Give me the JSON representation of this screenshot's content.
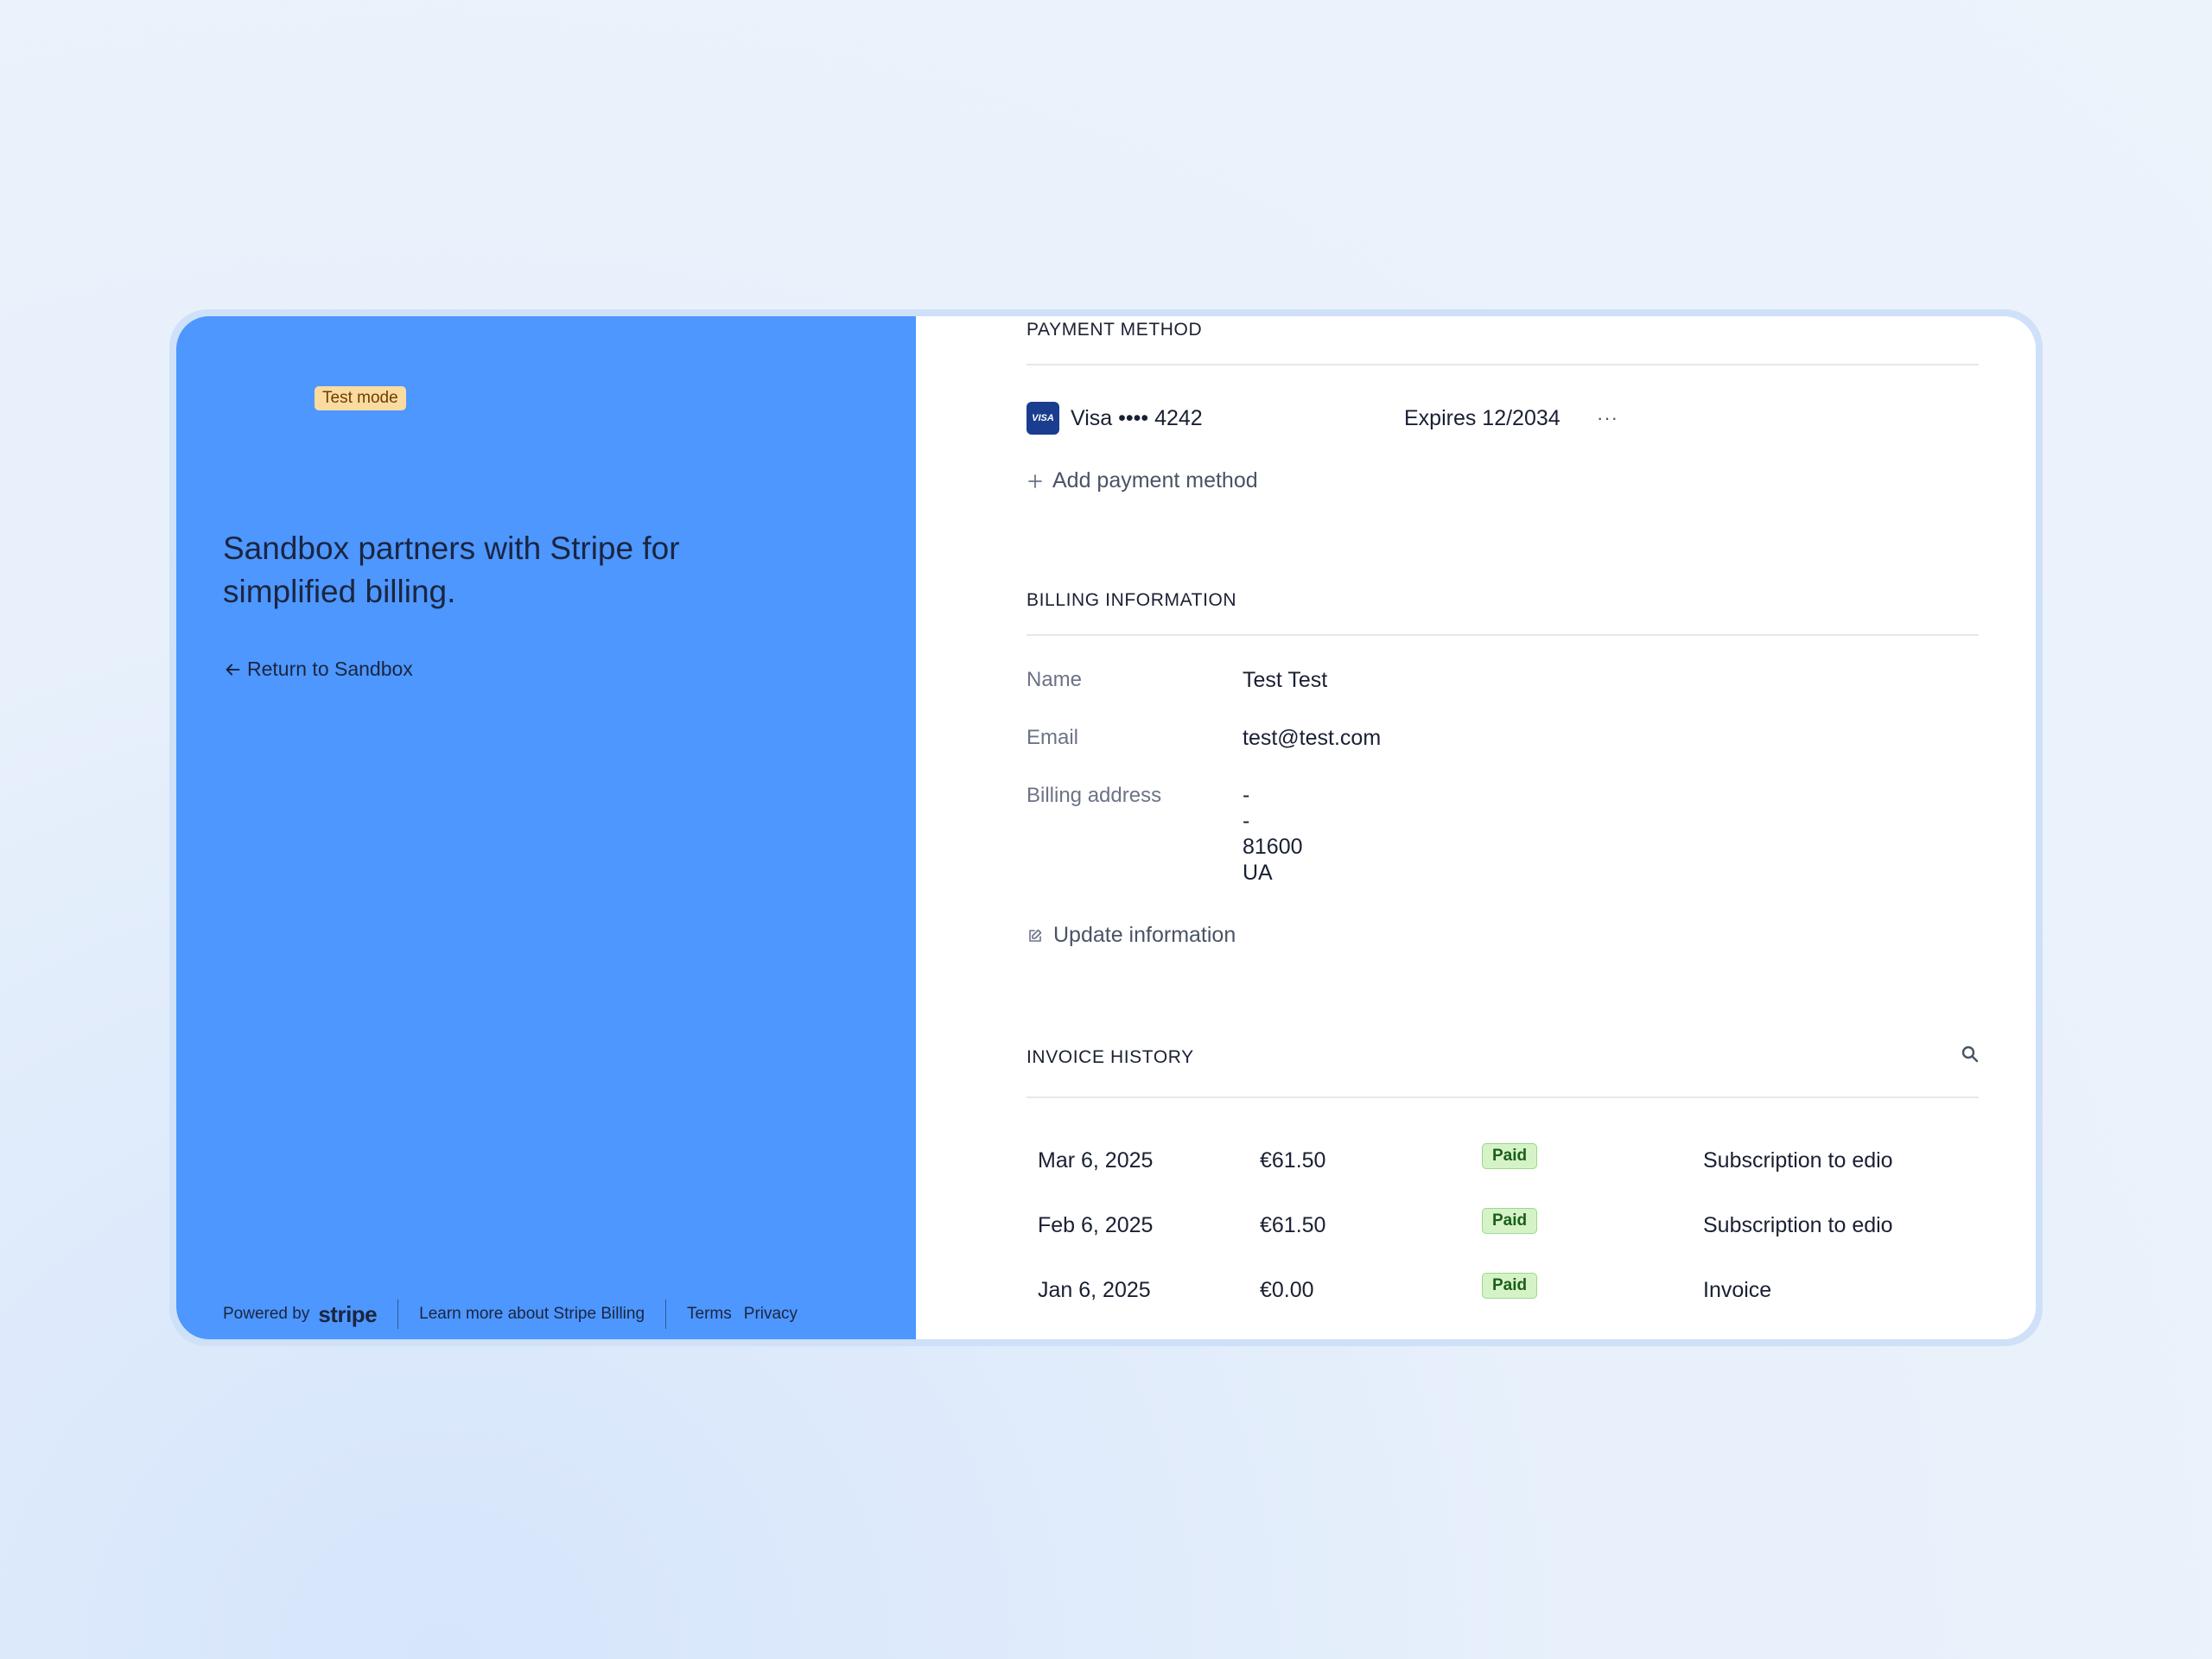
{
  "left": {
    "badge": "Test mode",
    "tagline": "Sandbox partners with Stripe for simplified billing.",
    "back_link": "Return to Sandbox",
    "footer": {
      "powered_by": "Powered by",
      "brand": "stripe",
      "learn_more": "Learn more about Stripe Billing",
      "terms": "Terms",
      "privacy": "Privacy"
    }
  },
  "payment_method": {
    "title": "PAYMENT METHOD",
    "card_brand_icon": "VISA",
    "card_label": "Visa •••• 4242",
    "expires": "Expires 12/2034",
    "more": "···",
    "add_label": "Add payment method"
  },
  "billing": {
    "title": "BILLING INFORMATION",
    "name_label": "Name",
    "name_value": "Test Test",
    "email_label": "Email",
    "email_value": "test@test.com",
    "address_label": "Billing address",
    "address_lines": [
      "-",
      "-",
      "81600",
      "UA"
    ],
    "update_label": "Update information"
  },
  "invoices": {
    "title": "INVOICE HISTORY",
    "rows": [
      {
        "date": "Mar 6, 2025",
        "amount": "€61.50",
        "status": "Paid",
        "description": "Subscription to edio"
      },
      {
        "date": "Feb 6, 2025",
        "amount": "€61.50",
        "status": "Paid",
        "description": "Subscription to edio"
      },
      {
        "date": "Jan 6, 2025",
        "amount": "€0.00",
        "status": "Paid",
        "description": "Invoice"
      }
    ]
  },
  "colors": {
    "left_panel": "#4d97fe",
    "badge_bg": "#fbdca0",
    "paid_bg": "#d5f3c7",
    "visa_blue": "#1a3d8f"
  }
}
